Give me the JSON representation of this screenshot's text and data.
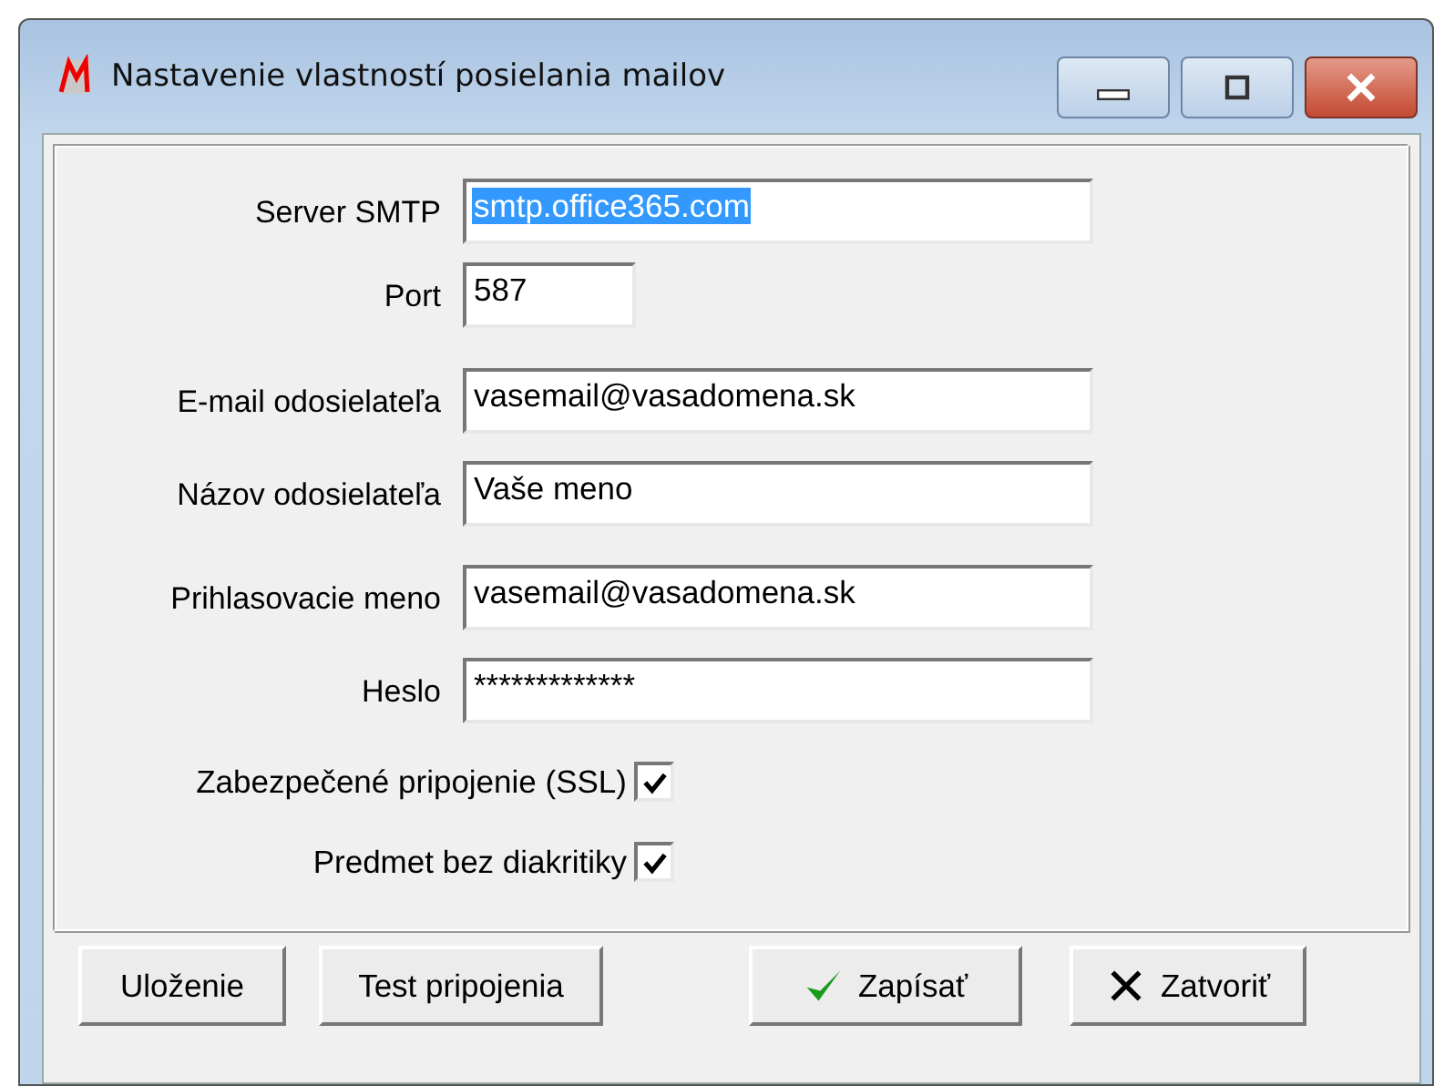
{
  "window": {
    "title": "Nastavenie vlastností posielania mailov"
  },
  "fields": [
    {
      "label": "Server SMTP",
      "value": "smtp.office365.com",
      "selected": true,
      "kind": "text"
    },
    {
      "label": "Port",
      "value": "587",
      "selected": false,
      "kind": "number"
    },
    {
      "label": "E-mail odosielateľa",
      "value": "vasemail@vasadomena.sk",
      "selected": false,
      "kind": "text"
    },
    {
      "label": "Názov odosielateľa",
      "value": "Vaše meno",
      "selected": false,
      "kind": "text"
    },
    {
      "label": "Prihlasovacie meno",
      "value": "vasemail@vasadomena.sk",
      "selected": false,
      "kind": "text"
    },
    {
      "label": "Heslo",
      "value": "*************",
      "selected": false,
      "kind": "text"
    }
  ],
  "checkboxes": [
    {
      "label": "Zabezpečené pripojenie (SSL)",
      "checked": true
    },
    {
      "label": "Predmet bez diakritiky",
      "checked": true
    }
  ],
  "buttons": [
    {
      "label": "Uloženie",
      "kind": "plain"
    },
    {
      "label": "Test pripojenia",
      "kind": "plain"
    },
    {
      "label": "Zapísať",
      "kind": "save"
    },
    {
      "label": "Zatvoriť",
      "kind": "close"
    }
  ]
}
